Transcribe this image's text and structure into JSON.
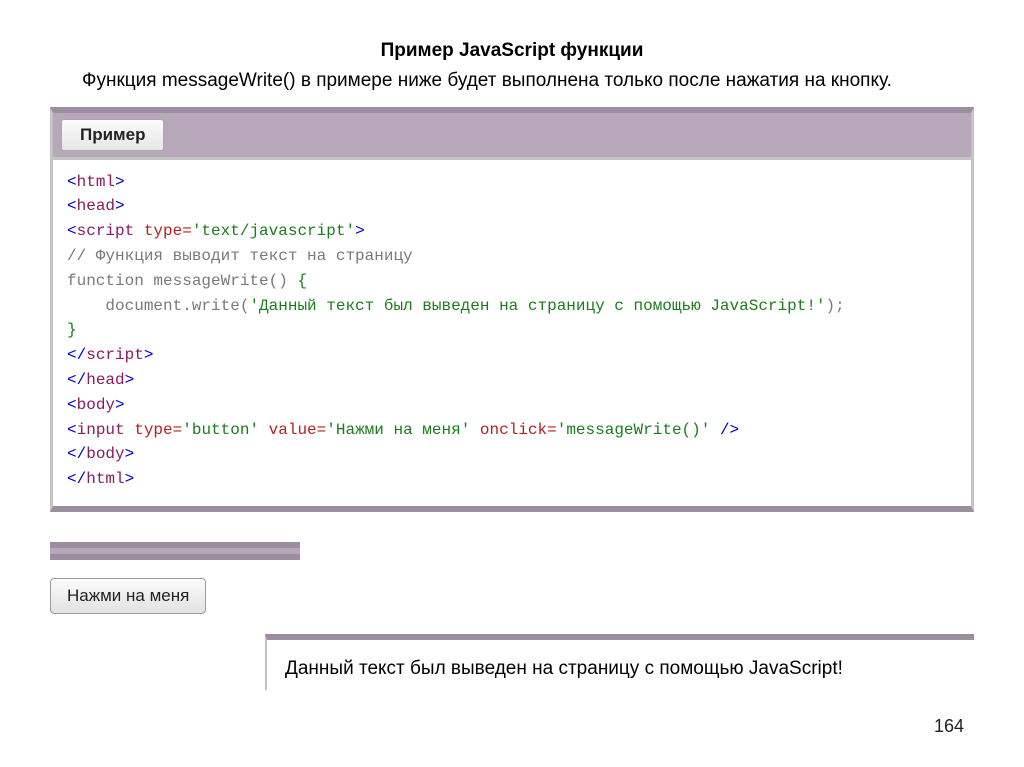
{
  "title": "Пример JavaScript функции",
  "intro": "Функция messageWrite() в примере ниже будет выполнена только после нажатия на кнопку.",
  "example": {
    "tab_label": "Пример",
    "code": {
      "l1_open": "<",
      "l1_name": "html",
      "l1_close": ">",
      "l2_open": "<",
      "l2_name": "head",
      "l2_close": ">",
      "l3_open": "<",
      "l3_name": "script",
      "l3_attr": " type=",
      "l3_str": "'text/javascript'",
      "l3_close": ">",
      "l4": "// Функция выводит текст на страницу",
      "l5_kw": "function",
      "l5_fn": " messageWrite() ",
      "l5_brace": "{",
      "l6_pre": "    ",
      "l6_call": "document.write(",
      "l6_str": "'Данный текст был выведен на страницу с помощью JavaScript!'",
      "l6_end": ");",
      "l7": "}",
      "l8_open": "<",
      "l8_slash": "/",
      "l8_name": "script",
      "l8_close": ">",
      "l9_open": "<",
      "l9_slash": "/",
      "l9_name": "head",
      "l9_close": ">",
      "l10_open": "<",
      "l10_name": "body",
      "l10_close": ">",
      "l11_open": "<",
      "l11_name": "input",
      "l11_a1": " type=",
      "l11_v1": "'button'",
      "l11_a2": " value=",
      "l11_v2": "'Нажми на меня'",
      "l11_a3": " onclick=",
      "l11_v3": "'messageWrite()'",
      "l11_close": " />",
      "l12_open": "<",
      "l12_slash": "/",
      "l12_name": "body",
      "l12_close": ">",
      "l13_open": "<",
      "l13_slash": "/",
      "l13_name": "html",
      "l13_close": ">"
    }
  },
  "run_button": "Нажми на меня",
  "result_text": "Данный текст был выведен на страницу с помощью JavaScript!",
  "page_number": "164"
}
